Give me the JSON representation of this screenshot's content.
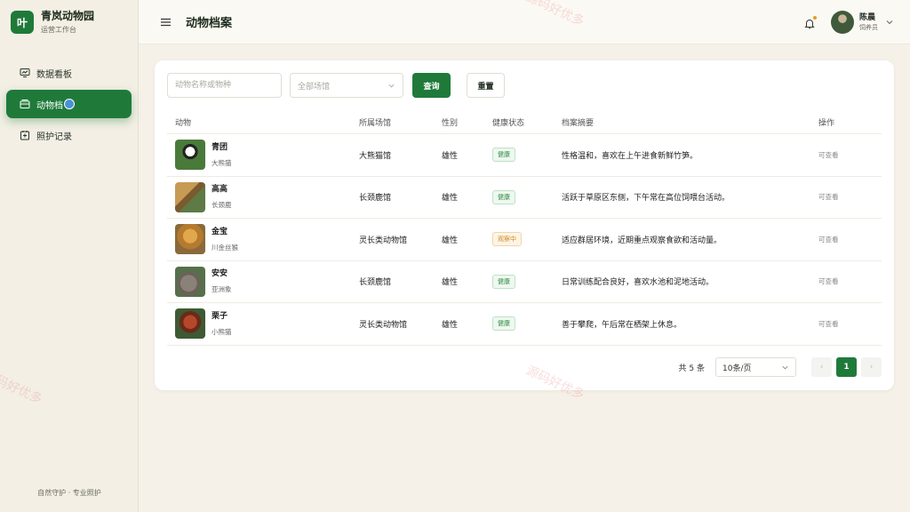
{
  "brand": {
    "logo_char": "叶",
    "name": "青岚动物园",
    "subtitle": "运营工作台"
  },
  "sidebar": {
    "items": [
      {
        "label": "数据看板",
        "icon": "dashboard-icon",
        "active": false
      },
      {
        "label": "动物档",
        "icon": "archive-icon",
        "active": true
      },
      {
        "label": "照护记录",
        "icon": "care-record-icon",
        "active": false
      }
    ],
    "footer": "自然守护 · 专业照护"
  },
  "header": {
    "title": "动物档案",
    "user": {
      "name": "陈晨",
      "role": "饲养员"
    }
  },
  "filters": {
    "search_placeholder": "动物名称或物种",
    "venue_placeholder": "全部场馆",
    "query_label": "查询",
    "reset_label": "重置"
  },
  "table": {
    "columns": [
      "动物",
      "所属场馆",
      "性别",
      "健康状态",
      "档案摘要",
      "操作"
    ],
    "rows": [
      {
        "name": "青团",
        "species": "大熊猫",
        "venue": "大熊猫馆",
        "gender": "雄性",
        "status": "健康",
        "status_type": "ok",
        "summary": "性格温和，喜欢在上午进食新鲜竹笋。",
        "action": "可查看"
      },
      {
        "name": "高高",
        "species": "长颈鹿",
        "venue": "长颈鹿馆",
        "gender": "雄性",
        "status": "健康",
        "status_type": "ok",
        "summary": "活跃于草原区东侧，下午常在高位饲喂台活动。",
        "action": "可查看"
      },
      {
        "name": "金宝",
        "species": "川金丝猴",
        "venue": "灵长类动物馆",
        "gender": "雄性",
        "status": "观察中",
        "status_type": "warn",
        "summary": "适应群居环境，近期重点观察食欲和活动量。",
        "action": "可查看"
      },
      {
        "name": "安安",
        "species": "亚洲象",
        "venue": "长颈鹿馆",
        "gender": "雄性",
        "status": "健康",
        "status_type": "ok",
        "summary": "日常训练配合良好，喜欢水池和泥地活动。",
        "action": "可查看"
      },
      {
        "name": "栗子",
        "species": "小熊猫",
        "venue": "灵长类动物馆",
        "gender": "雄性",
        "status": "健康",
        "status_type": "ok",
        "summary": "善于攀爬，午后常在栖架上休息。",
        "action": "可查看"
      }
    ]
  },
  "pagination": {
    "total_text": "共 5 条",
    "page_size": "10条/页",
    "current_page": "1",
    "prev": "‹",
    "next": "›"
  },
  "watermark": "源码好优多",
  "colors": {
    "primary": "#1f7a3a",
    "ok": "#2f8a45",
    "warn": "#d08a22"
  }
}
